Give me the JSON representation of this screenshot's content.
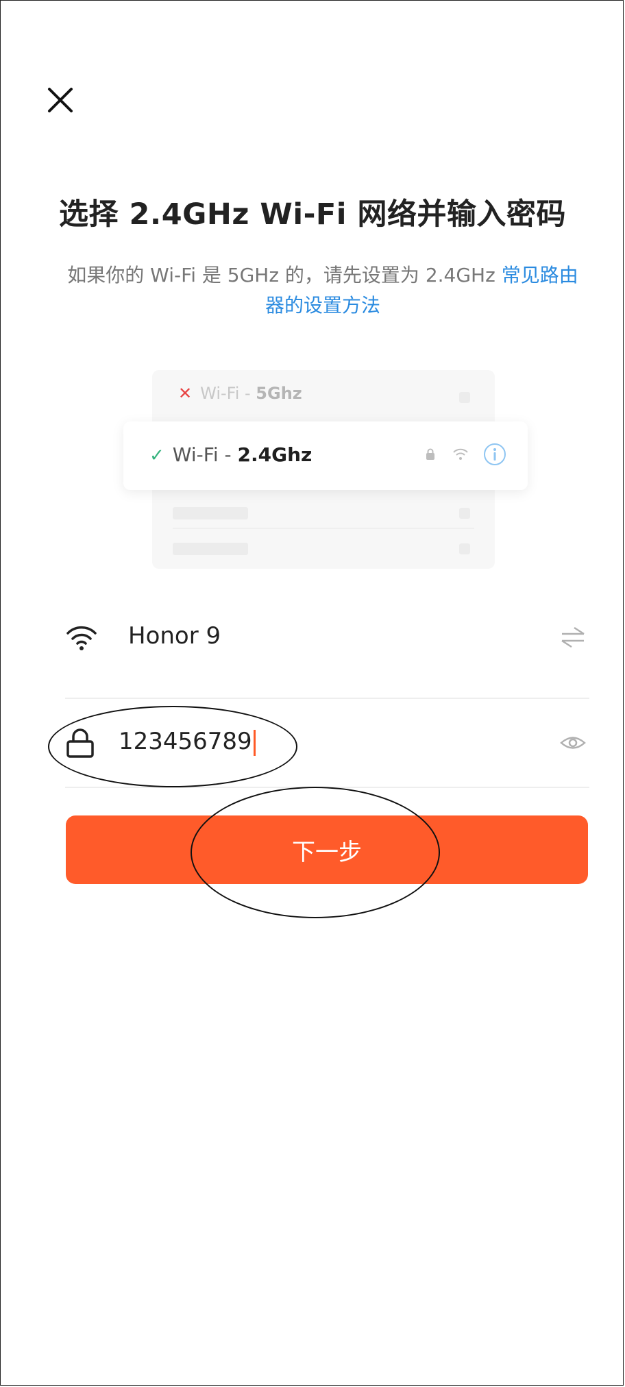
{
  "header": {
    "close_icon": "close-icon"
  },
  "title": "选择 2.4GHz Wi-Fi 网络并输入密码",
  "subtitle": {
    "text": "如果你的 Wi-Fi 是 5GHz 的，请先设置为 2.4GHz ",
    "link": "常见路由器的设置方法"
  },
  "illustration": {
    "bad_prefix": "Wi-Fi - ",
    "bad_band": "5Ghz",
    "good_prefix": "Wi-Fi - ",
    "good_band": "2.4Ghz"
  },
  "wifi_field": {
    "icon": "wifi-icon",
    "value": "Honor 9",
    "switch_icon": "switch-network-icon"
  },
  "password_field": {
    "icon": "lock-icon",
    "value": "123456789",
    "visibility_icon": "eye-icon"
  },
  "next_button": {
    "label": "下一步"
  },
  "colors": {
    "accent": "#ff5b2a",
    "link": "#2b8be0",
    "error": "#e84343",
    "success": "#36b37e"
  }
}
